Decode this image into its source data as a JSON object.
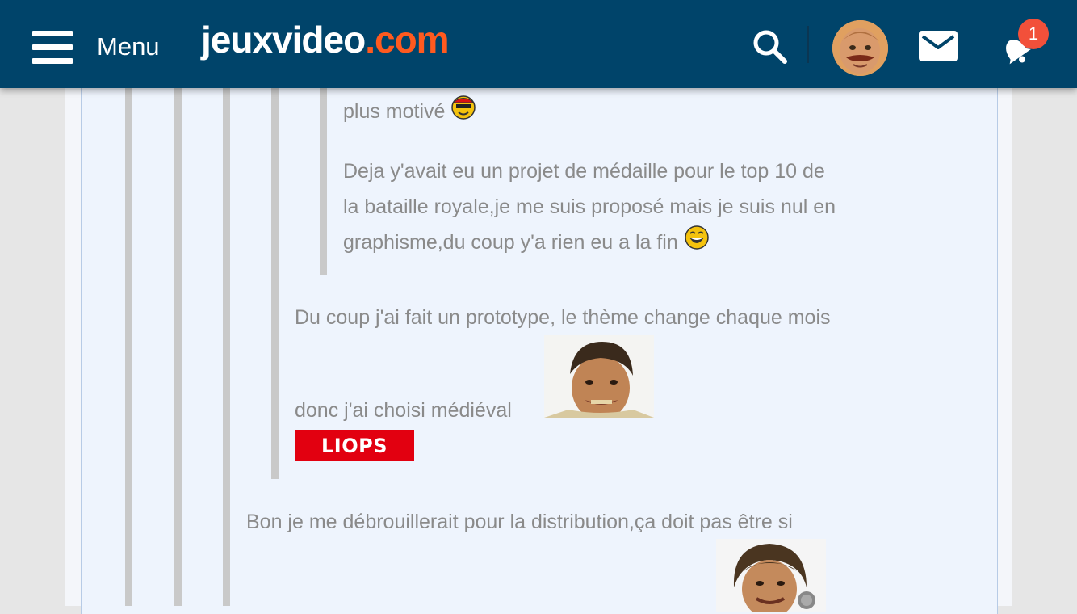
{
  "header": {
    "menu_label": "Menu",
    "logo_part1": "jeuxvideo",
    "logo_part2": ".com",
    "notification_count": "1",
    "icons": [
      "hamburger-icon",
      "search-icon",
      "mail-icon",
      "notification-icon"
    ],
    "colors": {
      "bar": "#00446a",
      "logo_accent": "#ff5a1f",
      "badge": "#f2503a"
    }
  },
  "post": {
    "quote_level3": {
      "line1": "plus motivé",
      "para2_line1": "Deja y'avait eu un projet de médaille pour le top 10 de",
      "para2_line2": "la bataille royale,je me suis proposé mais je suis nul en",
      "para2_line3": "graphisme,du coup y'a rien eu a la fin"
    },
    "quote_level2": {
      "line1": "Du coup j'ai fait un prototype, le thème change chaque mois",
      "line2": "donc j'ai choisi médiéval",
      "tag_label": "LIOPS"
    },
    "body": {
      "line1": "Bon je me débrouillerait pour la distribution,ça doit pas être si"
    },
    "colors": {
      "text": "#8a8a8a",
      "background": "#eef4fd",
      "quote_bar": "#c9c9c9",
      "tag": "#e20010"
    }
  }
}
